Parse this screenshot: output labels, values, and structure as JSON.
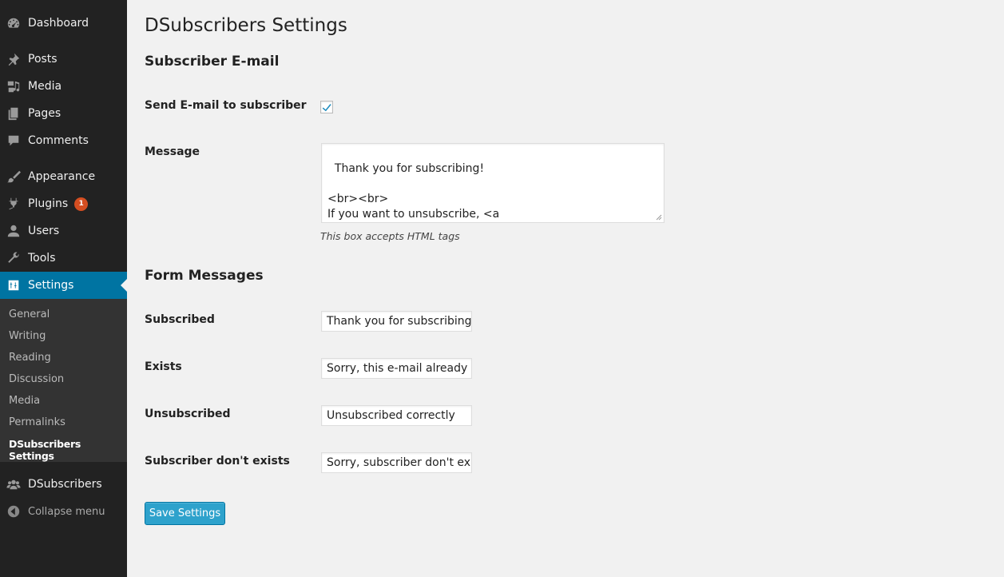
{
  "sidebar": {
    "items": [
      {
        "label": "Dashboard",
        "icon": "dashboard-icon"
      },
      {
        "label": "Posts",
        "icon": "pin-icon"
      },
      {
        "label": "Media",
        "icon": "media-icon"
      },
      {
        "label": "Pages",
        "icon": "pages-icon"
      },
      {
        "label": "Comments",
        "icon": "comment-icon"
      },
      {
        "label": "Appearance",
        "icon": "brush-icon"
      },
      {
        "label": "Plugins",
        "icon": "plug-icon",
        "badge": "1"
      },
      {
        "label": "Users",
        "icon": "user-icon"
      },
      {
        "label": "Tools",
        "icon": "wrench-icon"
      },
      {
        "label": "Settings",
        "icon": "settings-icon",
        "current": true
      },
      {
        "label": "DSubscribers",
        "icon": "group-icon"
      },
      {
        "label": "Collapse menu",
        "icon": "collapse-arrow-icon"
      }
    ],
    "submenu": [
      "General",
      "Writing",
      "Reading",
      "Discussion",
      "Media",
      "Permalinks",
      "DSubscribers Settings"
    ]
  },
  "page": {
    "title": "DSubscribers Settings",
    "section_email": "Subscriber E-mail",
    "send_email_label": "Send E-mail to subscriber",
    "send_email_checked": true,
    "message_label": "Message",
    "message_value": "Thank you for subscribing!\n\n<br><br>\nIf you want to unsubscribe, <a href=\"http://www.example.com/unsubscribe\">click here</a>",
    "message_hint": "This box accepts HTML tags",
    "section_form": "Form Messages",
    "fields": [
      {
        "label": "Subscribed",
        "value": "Thank you for subscribing!"
      },
      {
        "label": "Exists",
        "value": "Sorry, this e-mail already exists"
      },
      {
        "label": "Unsubscribed",
        "value": "Unsubscribed correctly"
      },
      {
        "label": "Subscriber don't exists",
        "value": "Sorry, subscriber don't exists"
      }
    ],
    "save_label": "Save Settings"
  },
  "colors": {
    "sidebar_bg": "#222222",
    "submenu_bg": "#333333",
    "current_menu": "#0074a2",
    "button_primary": "#2ea2cc",
    "badge": "#d54e21",
    "page_bg": "#f1f1f1"
  }
}
